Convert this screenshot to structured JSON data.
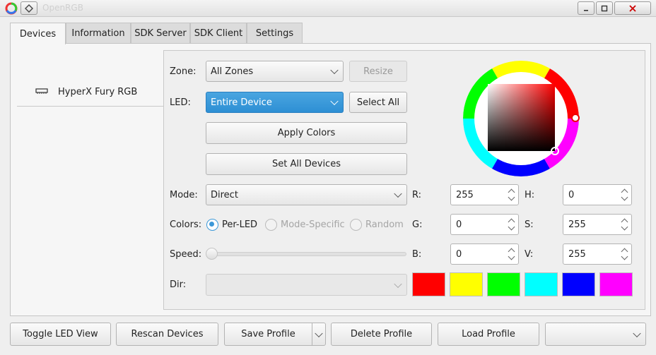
{
  "window": {
    "title": "OpenRGB"
  },
  "tabs": [
    "Devices",
    "Information",
    "SDK Server",
    "SDK Client",
    "Settings"
  ],
  "device_list": {
    "items": [
      "HyperX Fury RGB"
    ]
  },
  "labels": {
    "zone": "Zone:",
    "led": "LED:",
    "mode": "Mode:",
    "colors": "Colors:",
    "speed": "Speed:",
    "dir": "Dir:",
    "r": "R:",
    "g": "G:",
    "b": "B:",
    "h": "H:",
    "s": "S:",
    "v": "V:"
  },
  "zone": {
    "value": "All Zones"
  },
  "led": {
    "value": "Entire Device"
  },
  "mode": {
    "value": "Direct"
  },
  "dir": {
    "value": ""
  },
  "buttons": {
    "resize": "Resize",
    "select_all": "Select All",
    "apply_colors": "Apply Colors",
    "set_all_devices": "Set All Devices"
  },
  "color_modes": {
    "per_led": "Per-LED",
    "mode_specific": "Mode-Specific",
    "random": "Random",
    "selected": "per_led"
  },
  "speed": {
    "value": 0
  },
  "rgb": {
    "r": "255",
    "g": "0",
    "b": "0"
  },
  "hsv": {
    "h": "0",
    "s": "255",
    "v": "255"
  },
  "swatches": [
    "#ff0000",
    "#ffff00",
    "#00ff00",
    "#00ffff",
    "#0000ff",
    "#ff00ff"
  ],
  "bottom": {
    "toggle_led_view": "Toggle LED View",
    "rescan_devices": "Rescan Devices",
    "save_profile": "Save Profile",
    "delete_profile": "Delete Profile",
    "load_profile": "Load Profile",
    "profile_select": ""
  }
}
